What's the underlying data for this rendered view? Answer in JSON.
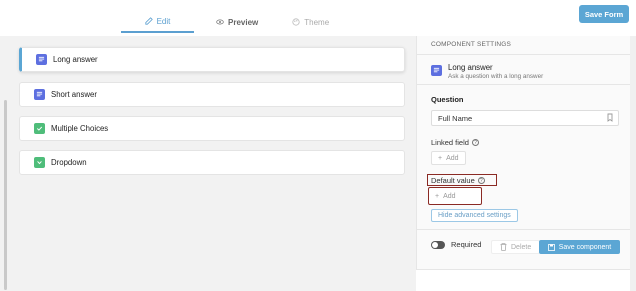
{
  "tabs": [
    {
      "label": "Edit",
      "icon": "pencil-icon",
      "active": true
    },
    {
      "label": "Preview",
      "icon": "eye-icon",
      "active": false
    },
    {
      "label": "Theme",
      "icon": "palette-icon",
      "active": false
    }
  ],
  "save_form_label": "Save Form",
  "fields": [
    {
      "label": "Long answer",
      "icon": "text-lines-icon",
      "color": "#5d6fe0",
      "selected": true
    },
    {
      "label": "Short answer",
      "icon": "text-lines-icon",
      "color": "#5d6fe0",
      "selected": false
    },
    {
      "label": "Multiple Choices",
      "icon": "check-icon",
      "color": "#4fbd7a",
      "selected": false
    },
    {
      "label": "Dropdown",
      "icon": "chevron-down-icon",
      "color": "#4fbd7a",
      "selected": false
    }
  ],
  "panel": {
    "heading": "COMPONENT SETTINGS",
    "component_title": "Long answer",
    "component_subtitle": "Ask a question with a long answer",
    "question_label": "Question",
    "question_value": "Full Name",
    "linked_field_label": "Linked field",
    "linked_add_label": "Add",
    "default_value_label": "Default value",
    "default_add_label": "Add",
    "hide_advanced_label": "Hide advanced settings",
    "required_label": "Required",
    "delete_label": "Delete",
    "save_component_label": "Save component"
  },
  "colors": {
    "accent": "#5ba6d4",
    "highlight": "#8b2a24"
  }
}
